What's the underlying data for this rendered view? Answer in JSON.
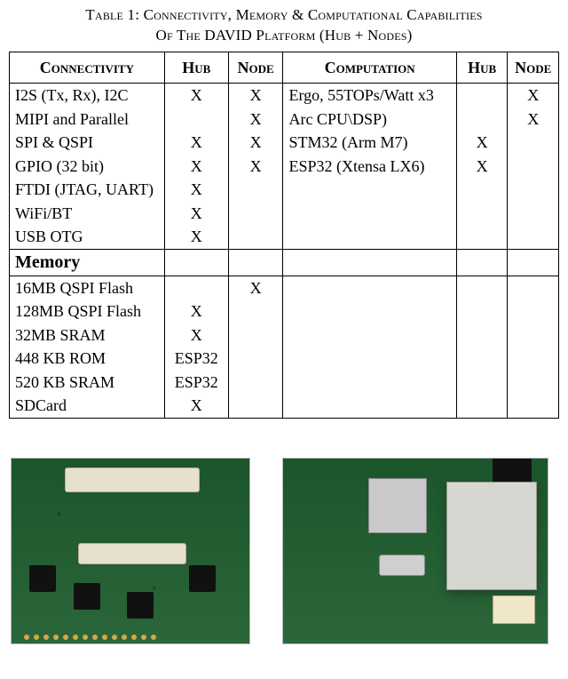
{
  "caption": {
    "line1": "Table 1: Connectivity, Memory & Computational Capabilities",
    "line2": "Of The DAVID Platform (Hub + Nodes)"
  },
  "headers": {
    "connectivity": "Connectivity",
    "hub": "Hub",
    "node": "Node",
    "computation": "Computation",
    "hub2": "Hub",
    "node2": "Node"
  },
  "section_memory": "Memory",
  "chart_data": {
    "type": "table",
    "title": "Connectivity, Memory & Computational Capabilities Of The DAVID Platform (Hub + Nodes)",
    "columns": [
      "Connectivity",
      "Hub",
      "Node",
      "Computation",
      "Hub",
      "Node"
    ],
    "rows_top": [
      {
        "conn": "I2S (Tx, Rx), I2C",
        "hub": "X",
        "node": "X",
        "comp": "Ergo, 55TOPs/Watt x3",
        "hub2": "",
        "node2": "X"
      },
      {
        "conn": "MIPI and Parallel",
        "hub": "",
        "node": "X",
        "comp": "Arc CPU\\DSP)",
        "hub2": "",
        "node2": "X"
      },
      {
        "conn": "SPI & QSPI",
        "hub": "X",
        "node": "X",
        "comp": "STM32 (Arm M7)",
        "hub2": "X",
        "node2": ""
      },
      {
        "conn": "GPIO (32 bit)",
        "hub": "X",
        "node": "X",
        "comp": "ESP32  (Xtensa LX6)",
        "hub2": "X",
        "node2": ""
      },
      {
        "conn": "FTDI (JTAG, UART)",
        "hub": "X",
        "node": "",
        "comp": "",
        "hub2": "",
        "node2": ""
      },
      {
        "conn": "WiFi/BT",
        "hub": "X",
        "node": "",
        "comp": "",
        "hub2": "",
        "node2": ""
      },
      {
        "conn": "USB OTG",
        "hub": "X",
        "node": "",
        "comp": "",
        "hub2": "",
        "node2": ""
      }
    ],
    "rows_memory": [
      {
        "conn": "16MB QSPI Flash",
        "hub": "",
        "node": "X",
        "comp": "",
        "hub2": "",
        "node2": ""
      },
      {
        "conn": "128MB QSPI Flash",
        "hub": "X",
        "node": "",
        "comp": "",
        "hub2": "",
        "node2": ""
      },
      {
        "conn": "32MB SRAM",
        "hub": "X",
        "node": "",
        "comp": "",
        "hub2": "",
        "node2": ""
      },
      {
        "conn": "448 KB ROM",
        "hub": "ESP32",
        "node": "",
        "comp": "",
        "hub2": "",
        "node2": ""
      },
      {
        "conn": "520 KB SRAM",
        "hub": "ESP32",
        "node": "",
        "comp": "",
        "hub2": "",
        "node2": ""
      },
      {
        "conn": "SDCard",
        "hub": "X",
        "node": "",
        "comp": "",
        "hub2": "",
        "node2": ""
      }
    ]
  }
}
